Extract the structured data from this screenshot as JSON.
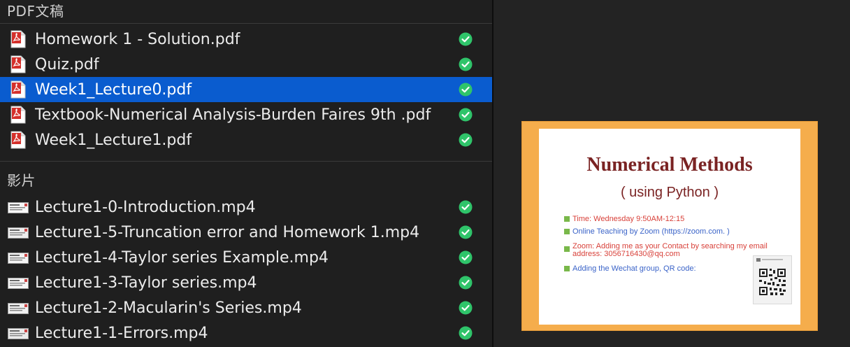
{
  "sections": {
    "pdf_header": "PDF文稿",
    "video_header": "影片"
  },
  "pdf_files": [
    {
      "name": "Homework 1 - Solution.pdf",
      "synced": true,
      "selected": false
    },
    {
      "name": "Quiz.pdf",
      "synced": true,
      "selected": false
    },
    {
      "name": "Week1_Lecture0.pdf",
      "synced": true,
      "selected": true
    },
    {
      "name": "Textbook-Numerical Analysis-Burden Faires 9th .pdf",
      "synced": true,
      "selected": false
    },
    {
      "name": "Week1_Lecture1.pdf",
      "synced": true,
      "selected": false
    }
  ],
  "video_files": [
    {
      "name": "Lecture1-0-Introduction.mp4",
      "synced": true
    },
    {
      "name": "Lecture1-5-Truncation error and Homework 1.mp4",
      "synced": true
    },
    {
      "name": "Lecture1-4-Taylor series Example.mp4",
      "synced": true
    },
    {
      "name": "Lecture1-3-Taylor series.mp4",
      "synced": true
    },
    {
      "name": "Lecture1-2-Macularin's Series.mp4",
      "synced": true
    },
    {
      "name": "Lecture1-1-Errors.mp4",
      "synced": true
    }
  ],
  "preview": {
    "title": "Numerical Methods",
    "subtitle": "( using Python )",
    "bullets": [
      {
        "text": "Time: Wednesday 9:50AM-12:15",
        "color": "red"
      },
      {
        "text": "Online Teaching by Zoom (https://zoom.com. )",
        "color": "blue"
      },
      {
        "text": "Zoom: Adding me as your Contact by searching my email",
        "text2": "address: 3056716430@qq.com",
        "color": "red"
      },
      {
        "text": "Adding the Wechat group,  QR code:",
        "color": "blue"
      }
    ]
  },
  "colors": {
    "selection": "#0a5ccf",
    "check_green": "#2fc46a",
    "pdf_red": "#d4302b",
    "slide_border": "#f5ad4c",
    "slide_title": "#7a2323"
  },
  "icons": {
    "pdf": "pdf-file-icon",
    "video": "video-thumbnail-icon",
    "synced": "green-checkmark-icon"
  }
}
